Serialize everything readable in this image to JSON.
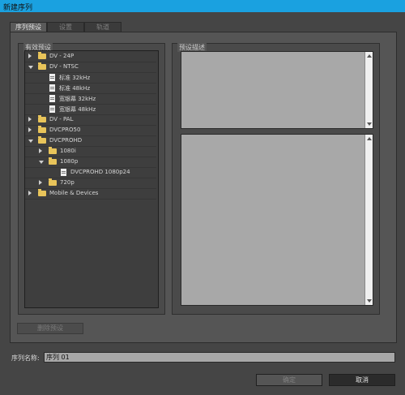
{
  "window": {
    "title": "新建序列"
  },
  "tabs": [
    {
      "label": "序列预设",
      "active": true
    },
    {
      "label": "设置",
      "active": false
    },
    {
      "label": "轨道",
      "active": false
    }
  ],
  "presets": {
    "group_label": "有效预设",
    "items": [
      {
        "label": "DV - 24P",
        "type": "folder",
        "expanded": false
      },
      {
        "label": "DV - NTSC",
        "type": "folder",
        "expanded": true
      },
      {
        "label": "标准 32kHz",
        "type": "file"
      },
      {
        "label": "标准 48kHz",
        "type": "file"
      },
      {
        "label": "宽银幕 32kHz",
        "type": "file"
      },
      {
        "label": "宽银幕 48kHz",
        "type": "file"
      },
      {
        "label": "DV - PAL",
        "type": "folder",
        "expanded": false
      },
      {
        "label": "DVCPRO50",
        "type": "folder",
        "expanded": false
      },
      {
        "label": "DVCPROHD",
        "type": "folder",
        "expanded": true
      },
      {
        "label": "1080i",
        "type": "folder",
        "expanded": false
      },
      {
        "label": "1080p",
        "type": "folder",
        "expanded": true
      },
      {
        "label": "DVCPROHD 1080p24",
        "type": "file"
      },
      {
        "label": "720p",
        "type": "folder",
        "expanded": false
      },
      {
        "label": "Mobile & Devices",
        "type": "folder",
        "expanded": false
      }
    ]
  },
  "description": {
    "group_label": "预设描述"
  },
  "delete_button": "删除预设",
  "sequence_name": {
    "label": "序列名称:",
    "value": "序列 01"
  },
  "buttons": {
    "ok": "确定",
    "cancel": "取消"
  },
  "colors": {
    "titlebar": "#1aa1e0",
    "folder": "#e8c45a"
  }
}
